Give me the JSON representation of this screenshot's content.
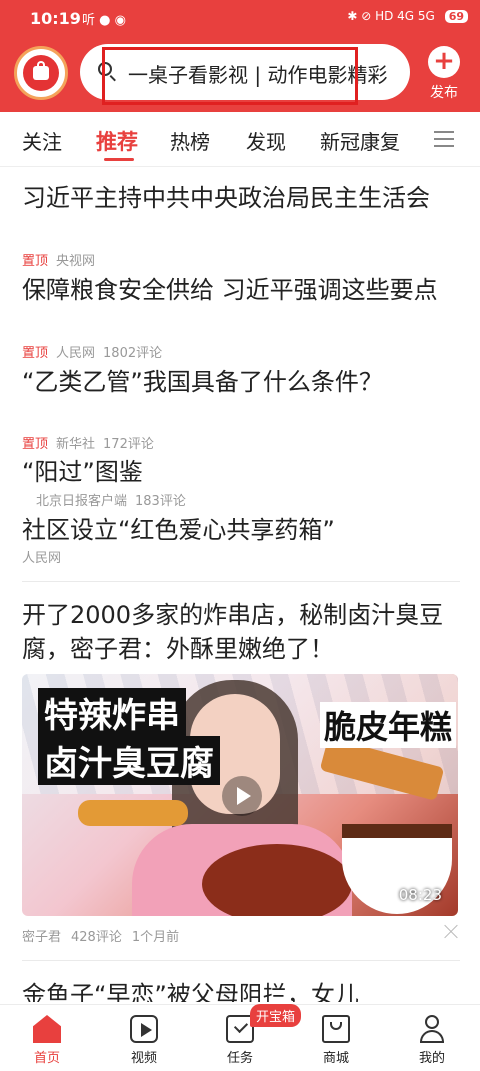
{
  "status_bar": {
    "time": "10:19",
    "left_icons": "听 ● ◉",
    "right_icons": "✱ ⊘ HD 4G 5G",
    "battery": "69"
  },
  "search": {
    "placeholder": "一桌子看影视 | 动作电影精彩"
  },
  "publish_label": "发布",
  "tabs": [
    {
      "label": "关注"
    },
    {
      "label": "推荐"
    },
    {
      "label": "热榜"
    },
    {
      "label": "发现"
    },
    {
      "label": "新冠康复"
    }
  ],
  "top_news": [
    {
      "title": "习近平主持中共中央政治局民主生活会",
      "pin": "置顶",
      "source": "央视网",
      "comments": ""
    },
    {
      "title": "保障粮食安全供给 习近平强调这些要点",
      "pin": "置顶",
      "source": "人民网",
      "comments": "1802评论"
    },
    {
      "title": "“乙类乙管”我国具备了什么条件？",
      "pin": "置顶",
      "source": "新华社",
      "comments": "172评论"
    },
    {
      "title": "“阳过”图鉴",
      "pin": "",
      "source": "北京日报客户端",
      "comments": "183评论"
    },
    {
      "title": "社区设立“红色爱心共享药箱”",
      "pin": "",
      "source": "人民网",
      "comments": ""
    }
  ],
  "article": {
    "title": "开了2000多家的炸串店，秘制卤汁臭豆腐，密子君：外酥里嫩绝了！",
    "thumb_caption_1": "特辣炸串",
    "thumb_caption_2": "卤汁臭豆腐",
    "thumb_caption_3": "脆皮年糕",
    "duration": "08:23",
    "author": "密子君",
    "comments": "428评论",
    "time": "1个月前"
  },
  "next_article_title": "金鱼子“早恋”被父母阻拦，女儿",
  "bottom_nav": [
    {
      "label": "首页"
    },
    {
      "label": "视频"
    },
    {
      "label": "任务"
    },
    {
      "label": "商城"
    },
    {
      "label": "我的"
    }
  ],
  "task_badge": "开宝箱",
  "colors": {
    "brand": "#e8403e"
  }
}
